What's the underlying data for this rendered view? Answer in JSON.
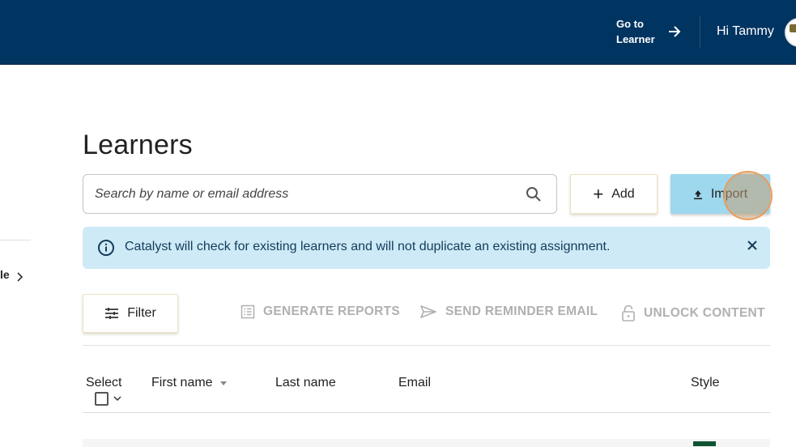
{
  "topbar": {
    "go_to_learner": "Go to Learner",
    "greeting": "Hi Tammy",
    "colors": {
      "background": "#003461",
      "text": "#ffffff"
    }
  },
  "sidebar": {
    "partial_item_label": "le"
  },
  "page": {
    "title": "Learners"
  },
  "search": {
    "placeholder": "Search by name or email address",
    "value": ""
  },
  "toolbar": {
    "add_label": "Add",
    "import_label": "Import",
    "filter_label": "Filter"
  },
  "info_banner": {
    "text": "Catalyst will check for existing learners and will not duplicate an existing assignment.",
    "background": "#cdeaf6"
  },
  "actions": [
    {
      "label": "GENERATE REPORTS",
      "icon": "report-list-icon",
      "enabled": false
    },
    {
      "label": "SEND REMINDER EMAIL",
      "icon": "send-icon",
      "enabled": false
    },
    {
      "label": "UNLOCK CONTENT",
      "icon": "unlock-icon",
      "enabled": false
    }
  ],
  "table": {
    "columns": [
      {
        "label": "Select"
      },
      {
        "label": "First name",
        "sorted": "descending"
      },
      {
        "label": "Last name"
      },
      {
        "label": "Email"
      },
      {
        "label": "Style"
      }
    ],
    "select_all_checked": false,
    "rows": [
      {
        "style_color": "#0e5432"
      }
    ]
  },
  "colors": {
    "import_button": "#9ed8ee",
    "disabled_action": "#b0b0b0"
  }
}
